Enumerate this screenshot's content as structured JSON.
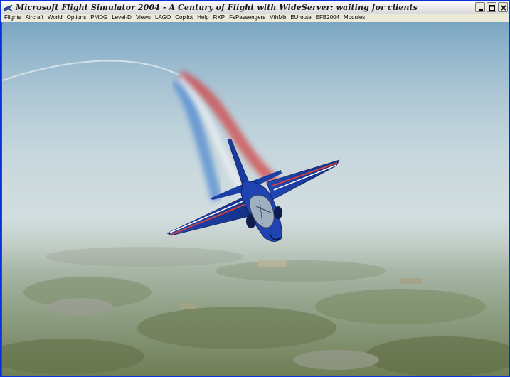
{
  "window": {
    "title": "Microsoft Flight Simulator 2004 - A Century of Flight with WideServer: waiting for clients"
  },
  "menu": {
    "items": [
      {
        "label": "Flights"
      },
      {
        "label": "Aircraft"
      },
      {
        "label": "World"
      },
      {
        "label": "Options"
      },
      {
        "label": "PMDG"
      },
      {
        "label": "Level-D"
      },
      {
        "label": "Views"
      },
      {
        "label": "LAGO"
      },
      {
        "label": "Copilot"
      },
      {
        "label": "Help"
      },
      {
        "label": "RXP"
      },
      {
        "label": "FsPassengers"
      },
      {
        "label": "VthMb"
      },
      {
        "label": "EUroute"
      },
      {
        "label": "EFB2004"
      },
      {
        "label": "Modules"
      }
    ]
  },
  "icons": {
    "app": "flight-sim-icon",
    "minimize": "minimize-icon",
    "maximize": "maximize-icon",
    "close": "close-icon"
  },
  "colors": {
    "sky_top": "#7fa8c4",
    "sky_horizon": "#c9d8dc",
    "ground_far": "#8a9a8e",
    "ground_near": "#6f7f58",
    "jet_blue": "#1a3fa8",
    "smoke_red": "#d03a3a",
    "smoke_blue": "#3f7fd0"
  }
}
